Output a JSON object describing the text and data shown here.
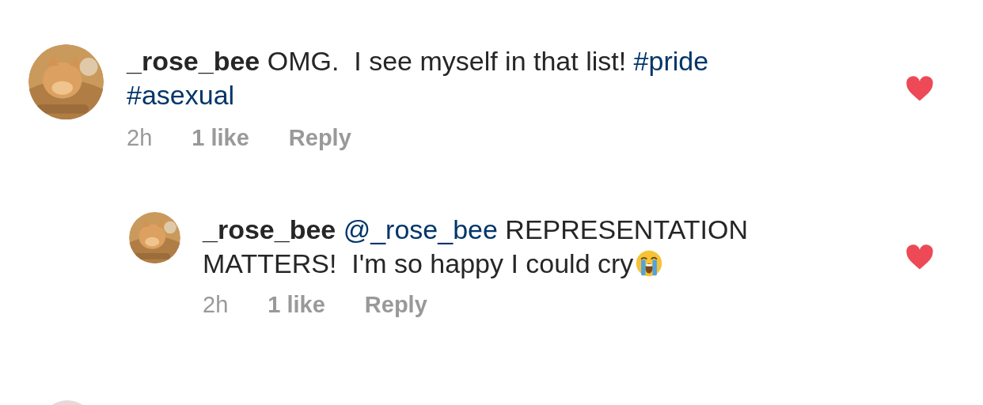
{
  "comments": [
    {
      "username": "_rose_bee",
      "reply": false,
      "liked": true,
      "time": "2h",
      "likes": "1 like",
      "reply_label": "Reply",
      "crying_emoji": false,
      "text": [
        {
          "kind": "text",
          "value": "OMG.  I see myself in that list!"
        },
        {
          "kind": "hashtag",
          "value": "#pride"
        },
        {
          "kind": "hashtag",
          "value": "#asexual"
        }
      ]
    },
    {
      "username": "_rose_bee",
      "reply": true,
      "liked": true,
      "time": "2h",
      "likes": "1 like",
      "reply_label": "Reply",
      "crying_emoji": true,
      "text": [
        {
          "kind": "mention",
          "value": "@_rose_bee"
        },
        {
          "kind": "text",
          "value": "REPRESENTATION MATTERS!  I'm so happy I could cry"
        }
      ]
    }
  ]
}
